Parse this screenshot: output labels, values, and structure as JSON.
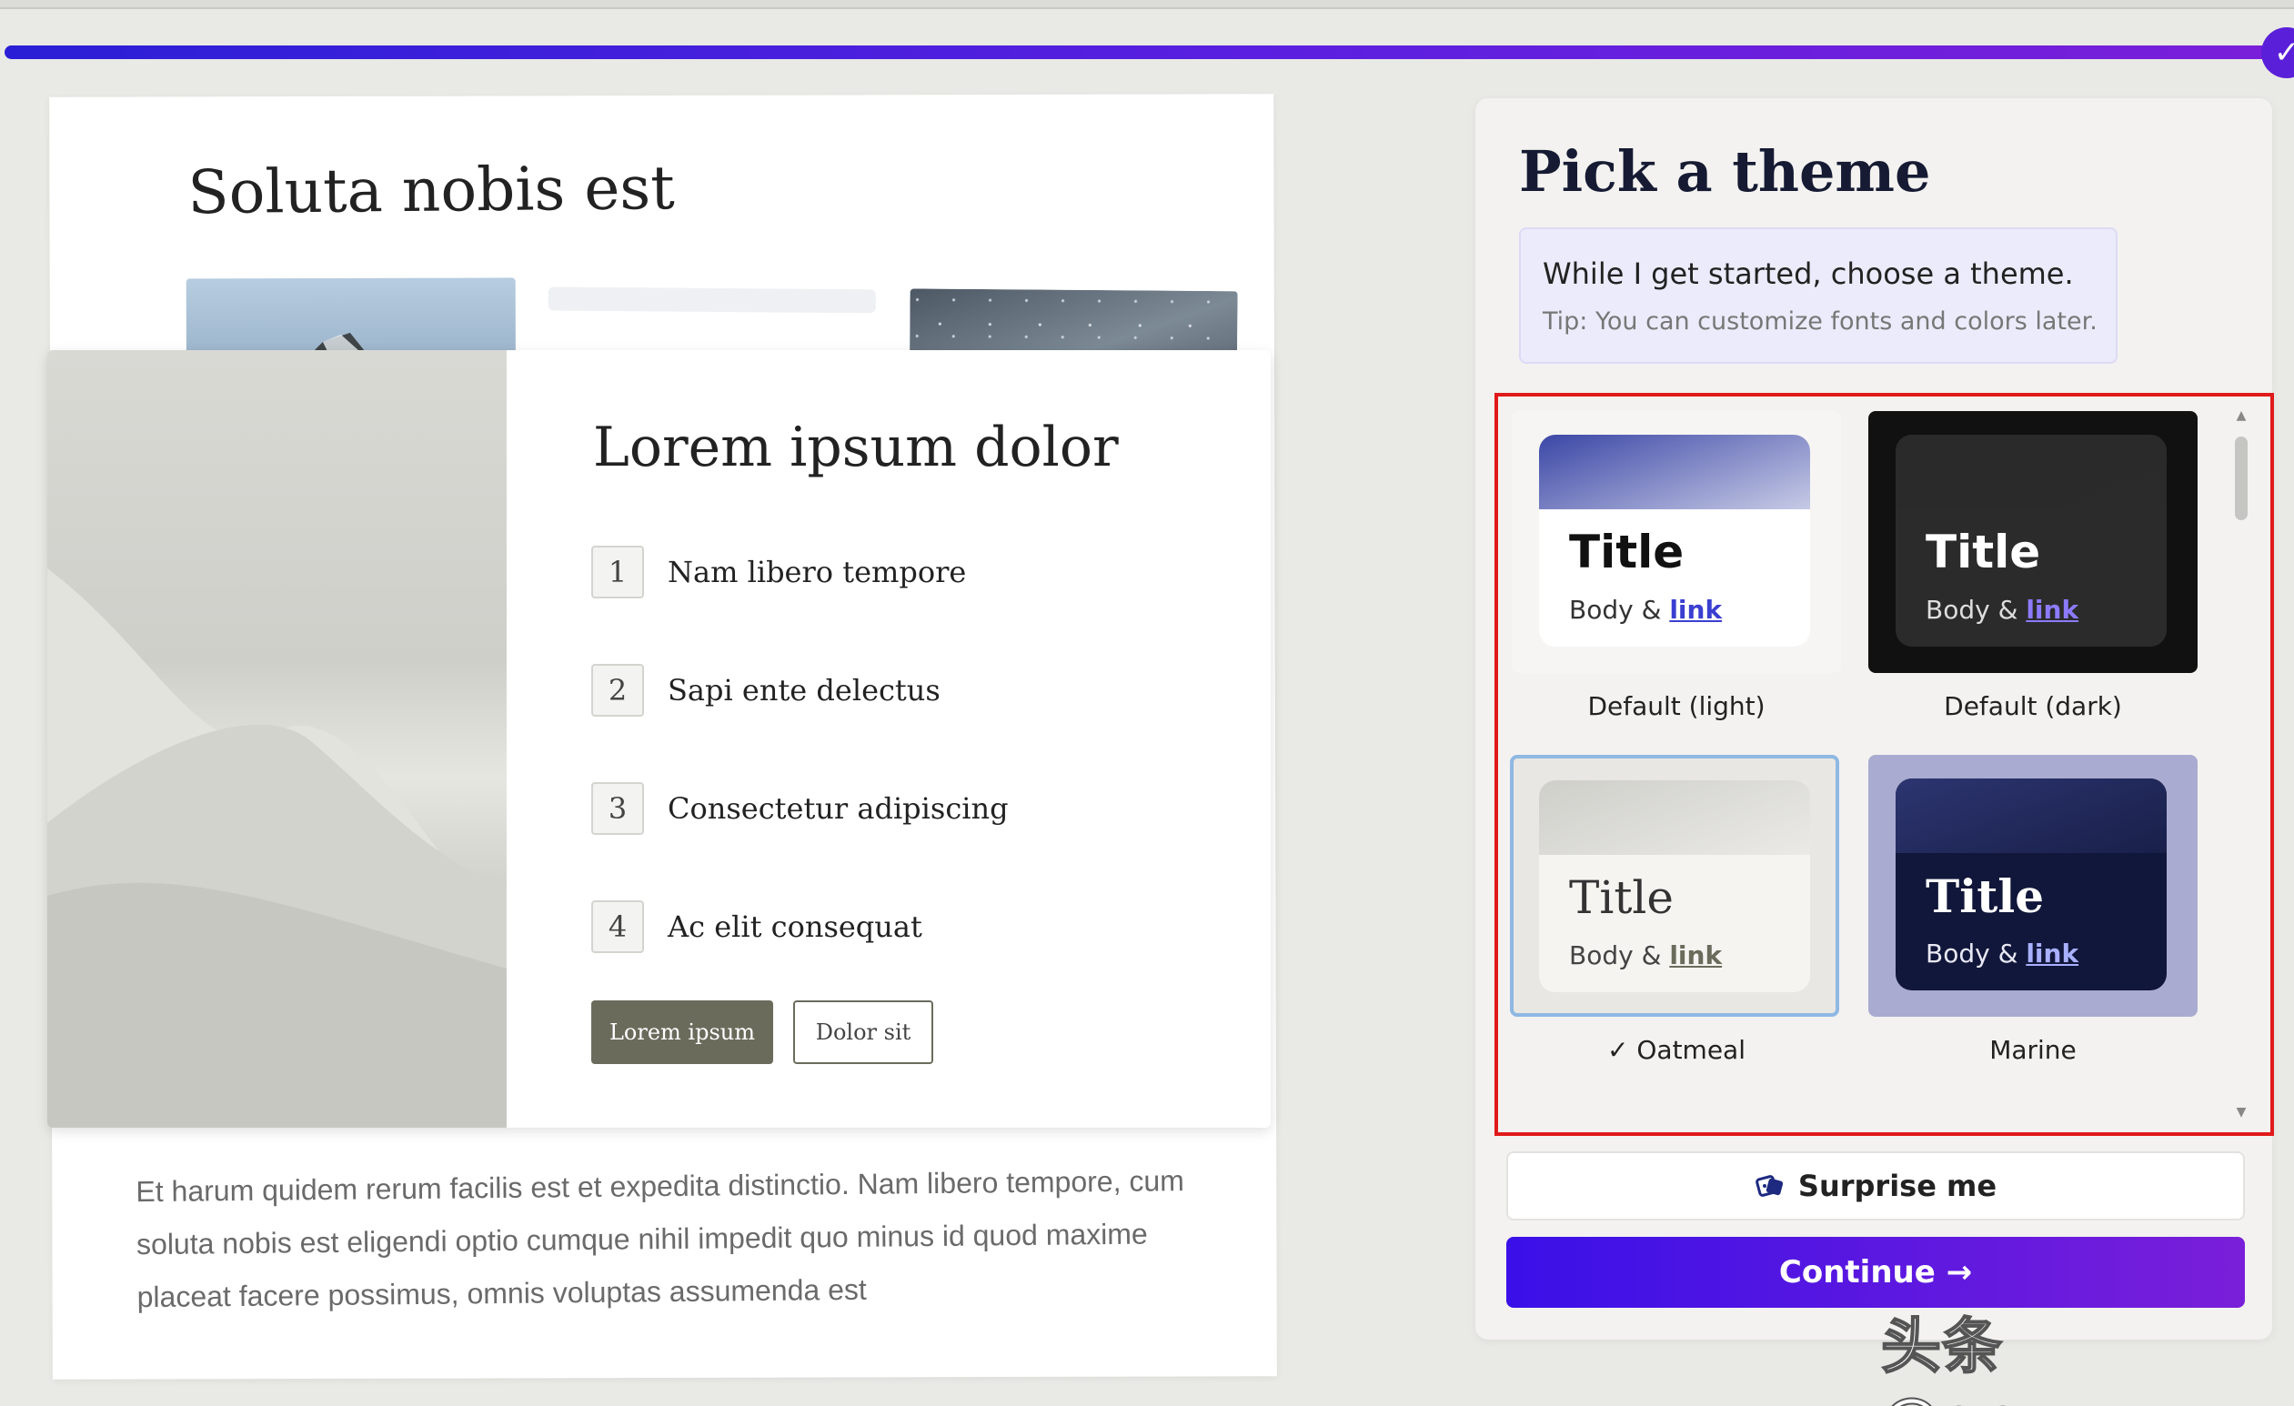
{
  "deck": {
    "back_title": "Soluta nobis est",
    "front_title": "Lorem ipsum dolor",
    "steps": [
      {
        "num": "1",
        "text": "Nam libero tempore"
      },
      {
        "num": "2",
        "text": "Sapi ente delectus"
      },
      {
        "num": "3",
        "text": "Consectetur adipiscing"
      },
      {
        "num": "4",
        "text": "Ac elit consequat"
      }
    ],
    "primary_button": "Lorem ipsum",
    "secondary_button": "Dolor sit",
    "paragraph": "Et harum quidem rerum facilis est et expedita distinctio. Nam libero tempore, cum soluta nobis est eligendi optio cumque nihil impedit quo minus id quod maxime placeat facere possimus, omnis voluptas assumenda est"
  },
  "panel": {
    "title": "Pick a theme",
    "info_main": "While I get started, choose a theme.",
    "info_tip": "Tip: You can customize fonts and colors later.",
    "preview_title": "Title",
    "preview_body": "Body & ",
    "preview_link": "link",
    "themes": [
      {
        "label": "Default (light)",
        "selected": false,
        "colors": {
          "card": "#f6f5f3",
          "band": "#3b47a6",
          "preview_bg": "#ffffff",
          "title": "#111111",
          "body": "#333333",
          "link": "#3b3fd0"
        }
      },
      {
        "label": "Default (dark)",
        "selected": false,
        "colors": {
          "card": "#111111",
          "band": "#2a2a2a",
          "preview_bg": "#2b2b2b",
          "title": "#ffffff",
          "body": "#dddddd",
          "link": "#8c7bff"
        }
      },
      {
        "label": "Oatmeal",
        "selected": true,
        "check": "✓",
        "colors": {
          "card": "#e8e7e3",
          "band": "#cfcfca",
          "preview_bg": "#f5f4f1",
          "title": "#333333",
          "body": "#444444",
          "link": "#6b6b5c"
        }
      },
      {
        "label": "Marine",
        "selected": false,
        "colors": {
          "card": "#a9abd0",
          "band": "#2c3570",
          "preview_bg": "#11173a",
          "title": "#ffffff",
          "body": "#e8e8f5",
          "link": "#a9b0ff"
        }
      }
    ],
    "surprise_label": "Surprise me",
    "surprise_icon": "dice-icon",
    "continue_label": "Continue →"
  },
  "watermark": "头条 @qqeva",
  "colors": {
    "accent": "#5a1fd9",
    "highlight": "#e01a1a"
  }
}
